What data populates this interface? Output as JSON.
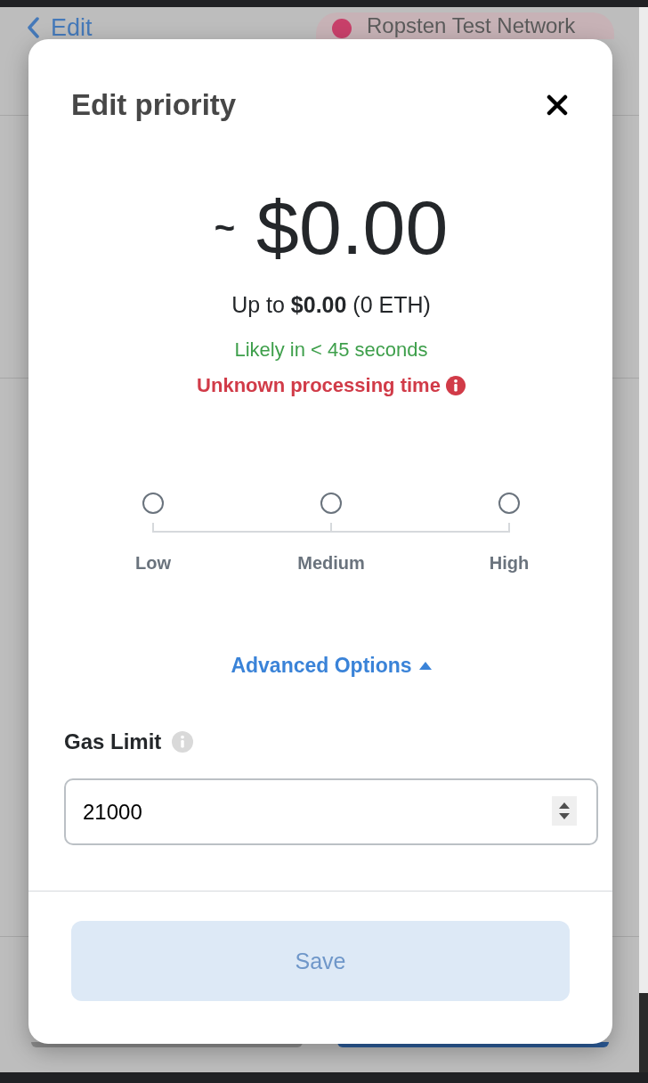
{
  "back_link": {
    "label": "Edit"
  },
  "network": {
    "label": "Ropsten Test Network"
  },
  "modal": {
    "title": "Edit priority",
    "estimate": {
      "prefix": "~",
      "amount": "$0.00"
    },
    "max_fee": "Up to **$0.00** (0 ETH)",
    "timing": [
      {
        "kind": "likely",
        "text": "Likely in < 45 seconds"
      },
      {
        "kind": "warning",
        "text": "Unknown processing time"
      }
    ],
    "priority_options": [
      {
        "label": "Low",
        "selected": false
      },
      {
        "label": "Medium",
        "selected": false
      },
      {
        "label": "High",
        "selected": false
      }
    ],
    "advanced_options": {
      "label": "Advanced Options",
      "expanded": true
    },
    "gas_limit": {
      "label": "Gas Limit",
      "value": "21000"
    },
    "save_button": {
      "label": "Save",
      "disabled": true
    }
  }
}
